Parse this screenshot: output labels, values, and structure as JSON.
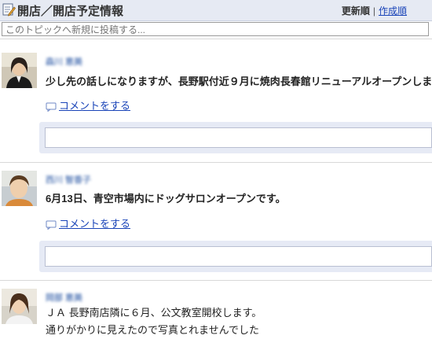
{
  "header": {
    "title": "開店／開店予定情報",
    "icon": "notepad-edit-icon",
    "sort_updated": "更新順",
    "sort_separator": "|",
    "sort_created": "作成順"
  },
  "new_topic": {
    "placeholder": "このトピックへ新規に投稿する..."
  },
  "posts": [
    {
      "author": "森川 恵美",
      "text": "少し先の話しになりますが、長野駅付近９月に焼肉長春館リニューアルオープンします。",
      "comment_link": "コメントをする"
    },
    {
      "author": "西川  智香子",
      "text": "6月13日、青空市場内にドッグサロンオープンです。",
      "comment_link": "コメントをする"
    },
    {
      "author": "岡部 恵美",
      "text_line1": "ＪＡ 長野南店隣に６月、公文教室開校します。",
      "text_line2": "通りがかりに見えたので写真とれませんでした"
    }
  ],
  "colors": {
    "header_bg": "#e6eaf3",
    "link": "#1a44b8",
    "comment_box_bg": "#e6eaf5"
  }
}
